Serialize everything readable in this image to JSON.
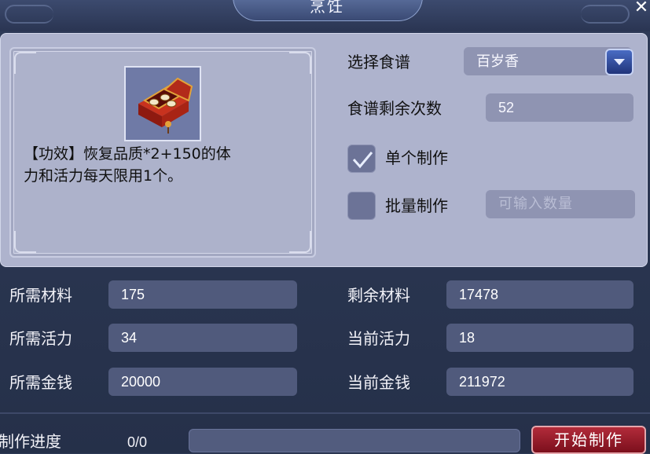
{
  "window": {
    "title": "烹饪",
    "close_symbol": "✕"
  },
  "description": {
    "icon": "treasure-chest-icon",
    "text_line1": "【功效】恢复品质*2+150的体",
    "text_line2": "力和活力每天限用1个。"
  },
  "options": {
    "recipe_label": "选择食谱",
    "recipe_value": "百岁香",
    "remaining_label": "食谱剩余次数",
    "remaining_value": "52",
    "single_label": "单个制作",
    "single_checked": true,
    "batch_label": "批量制作",
    "batch_checked": false,
    "batch_placeholder": "可输入数量"
  },
  "stats": {
    "required_material_label": "所需材料",
    "required_material_value": "175",
    "remaining_material_label": "剩余材料",
    "remaining_material_value": "17478",
    "required_vitality_label": "所需活力",
    "required_vitality_value": "34",
    "current_vitality_label": "当前活力",
    "current_vitality_value": "18",
    "required_money_label": "所需金钱",
    "required_money_value": "20000",
    "current_money_label": "当前金钱",
    "current_money_value": "211972"
  },
  "progress": {
    "label": "制作进度",
    "value_text": "0/0",
    "fraction": 0
  },
  "start_button": {
    "label": "开始制作"
  },
  "colors": {
    "panel_bg": "#aeb3cd",
    "field_bg": "#8f94b2",
    "dark_field_bg": "#505a7c",
    "window_bg": "#2e3a55",
    "start_button": "#9a1d2b"
  }
}
